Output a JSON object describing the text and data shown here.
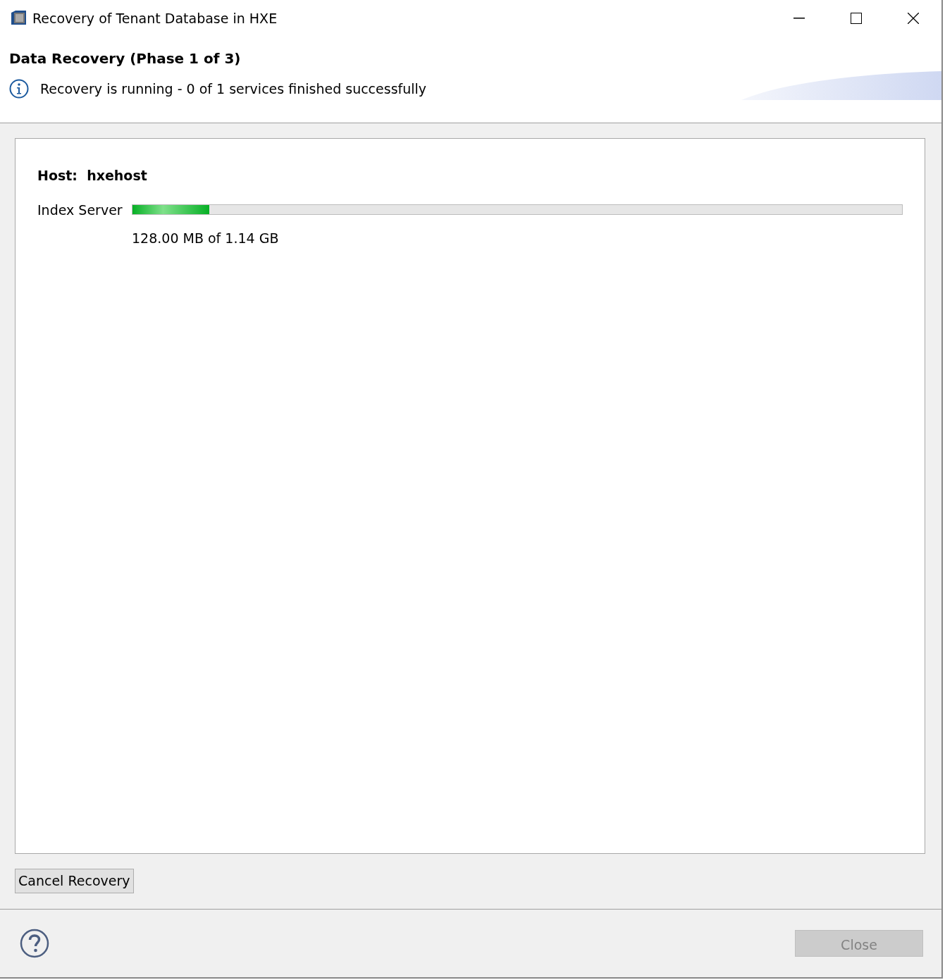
{
  "window": {
    "title": "Recovery of Tenant Database in HXE"
  },
  "header": {
    "title": "Data Recovery (Phase 1 of 3)",
    "message": "Recovery is running - 0 of 1 services finished successfully"
  },
  "host": {
    "label": "Host:",
    "name": "hxehost"
  },
  "services": [
    {
      "name": "Index Server",
      "level": 0.1,
      "reading": "128.00 MB of 1.14 GB"
    }
  ],
  "buttons": [
    {
      "label": "Cancel Recovery",
      "disabled": false
    }
  ],
  "footer": {
    "buttons": [
      {
        "label": "Close",
        "disabled": true
      }
    ]
  }
}
